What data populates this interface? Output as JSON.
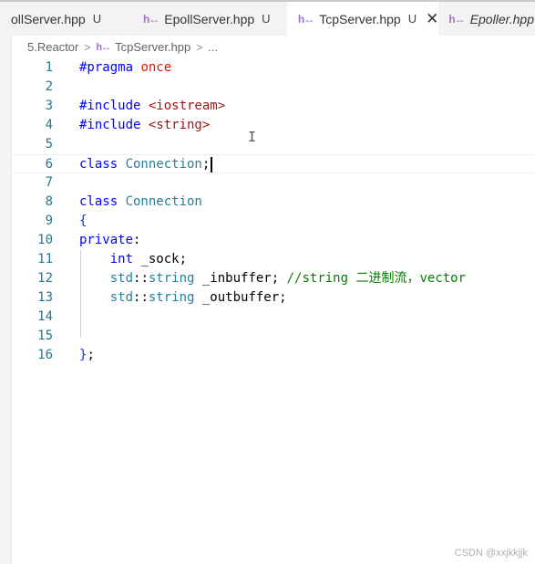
{
  "tabs": [
    {
      "icon": "h↔",
      "name": "ollServer.hpp",
      "badge": "U",
      "active": false
    },
    {
      "icon": "h↔",
      "name": "EpollServer.hpp",
      "badge": "U",
      "active": false
    },
    {
      "icon": "h↔",
      "name": "TcpServer.hpp",
      "badge": "U",
      "active": true,
      "close": "✕"
    },
    {
      "icon": "h↔",
      "name": "Epoller.hpp",
      "badge": "",
      "active": false
    }
  ],
  "breadcrumb": {
    "folder": "5.Reactor",
    "sep": ">",
    "icon": "h↔",
    "file": "TcpServer.hpp",
    "more": "..."
  },
  "editor": {
    "current_line": 6,
    "lines": [
      {
        "n": "1",
        "tokens": [
          [
            "#pragma ",
            "#0000ff"
          ],
          [
            "once",
            "#e51400"
          ]
        ]
      },
      {
        "n": "2",
        "tokens": []
      },
      {
        "n": "3",
        "tokens": [
          [
            "#include ",
            "#0000ff"
          ],
          [
            "<iostream>",
            "#a31515"
          ]
        ]
      },
      {
        "n": "4",
        "tokens": [
          [
            "#include ",
            "#0000ff"
          ],
          [
            "<string>",
            "#a31515"
          ]
        ]
      },
      {
        "n": "5",
        "tokens": []
      },
      {
        "n": "6",
        "tokens": [
          [
            "class ",
            "#0000ff"
          ],
          [
            "Connection",
            "#267f99"
          ],
          [
            ";",
            "#000000"
          ]
        ]
      },
      {
        "n": "7",
        "tokens": []
      },
      {
        "n": "8",
        "tokens": [
          [
            "class ",
            "#0000ff"
          ],
          [
            "Connection",
            "#267f99"
          ]
        ]
      },
      {
        "n": "9",
        "tokens": [
          [
            "{",
            "#0431fa"
          ]
        ]
      },
      {
        "n": "10",
        "tokens": [
          [
            "private",
            "#0000ff"
          ],
          [
            ":",
            "#000000"
          ]
        ]
      },
      {
        "n": "11",
        "tokens": [
          [
            "    ",
            "#000000"
          ],
          [
            "int",
            "#0000ff"
          ],
          [
            " _sock;",
            "#000000"
          ]
        ]
      },
      {
        "n": "12",
        "tokens": [
          [
            "    ",
            "#000000"
          ],
          [
            "std",
            "#267f99"
          ],
          [
            "::",
            "#000000"
          ],
          [
            "string",
            "#267f99"
          ],
          [
            " _inbuffer; ",
            "#000000"
          ],
          [
            "//string 二进制流，vector",
            "#008000"
          ]
        ]
      },
      {
        "n": "13",
        "tokens": [
          [
            "    ",
            "#000000"
          ],
          [
            "std",
            "#267f99"
          ],
          [
            "::",
            "#000000"
          ],
          [
            "string",
            "#267f99"
          ],
          [
            " _outbuffer;",
            "#000000"
          ]
        ]
      },
      {
        "n": "14",
        "tokens": []
      },
      {
        "n": "15",
        "tokens": []
      },
      {
        "n": "16",
        "tokens": [
          [
            "}",
            "#0431fa"
          ],
          [
            ";",
            "#000000"
          ]
        ]
      }
    ]
  },
  "ibeam_icon": "I",
  "watermark": "CSDN @xxjkkjjk"
}
